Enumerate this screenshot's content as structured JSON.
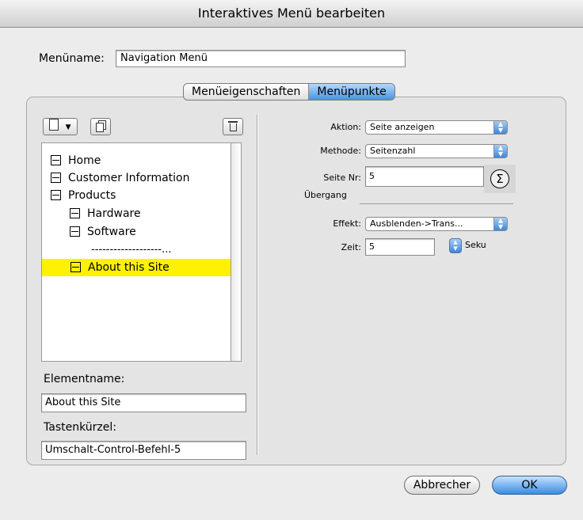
{
  "window": {
    "title": "Interaktives Menü bearbeiten"
  },
  "menuname": {
    "label": "Menüname:",
    "value": "Navigation Menü"
  },
  "tabs": [
    {
      "label": "Menüeigenschaften"
    },
    {
      "label": "Menüpunkte"
    }
  ],
  "toolbar": {
    "new_icon": "new-document-icon",
    "duplicate_icon": "duplicate-icon",
    "trash_icon": "trash-icon"
  },
  "tree": {
    "items": [
      {
        "label": "Home",
        "level": 0
      },
      {
        "label": "Customer Information",
        "level": 0
      },
      {
        "label": "Products",
        "level": 0
      },
      {
        "label": "Hardware",
        "level": 1
      },
      {
        "label": "Software",
        "level": 1
      },
      {
        "label": "-------------------...",
        "level": 2,
        "separator": true
      },
      {
        "label": "About this Site",
        "level": 1,
        "selected": true
      }
    ],
    "selected_color": "#fff100"
  },
  "element": {
    "label": "Elementname:",
    "value": "About this Site"
  },
  "shortcut": {
    "label": "Tastenkürzel:",
    "value": "Umschalt-Control-Befehl-5"
  },
  "right": {
    "aktion": {
      "label": "Aktion:",
      "value": "Seite anzeigen"
    },
    "methode": {
      "label": "Methode:",
      "value": "Seitenzahl"
    },
    "seite": {
      "label": "Seite Nr:",
      "value": "5"
    },
    "uebergang": {
      "label": "Übergang"
    },
    "effekt": {
      "label": "Effekt:",
      "value": "Ausblenden->Trans..."
    },
    "zeit": {
      "label": "Zeit:",
      "value": "5",
      "unit": "Seku"
    },
    "sigma": "Σ"
  },
  "buttons": {
    "cancel": "Abbrecher",
    "ok": "OK"
  }
}
